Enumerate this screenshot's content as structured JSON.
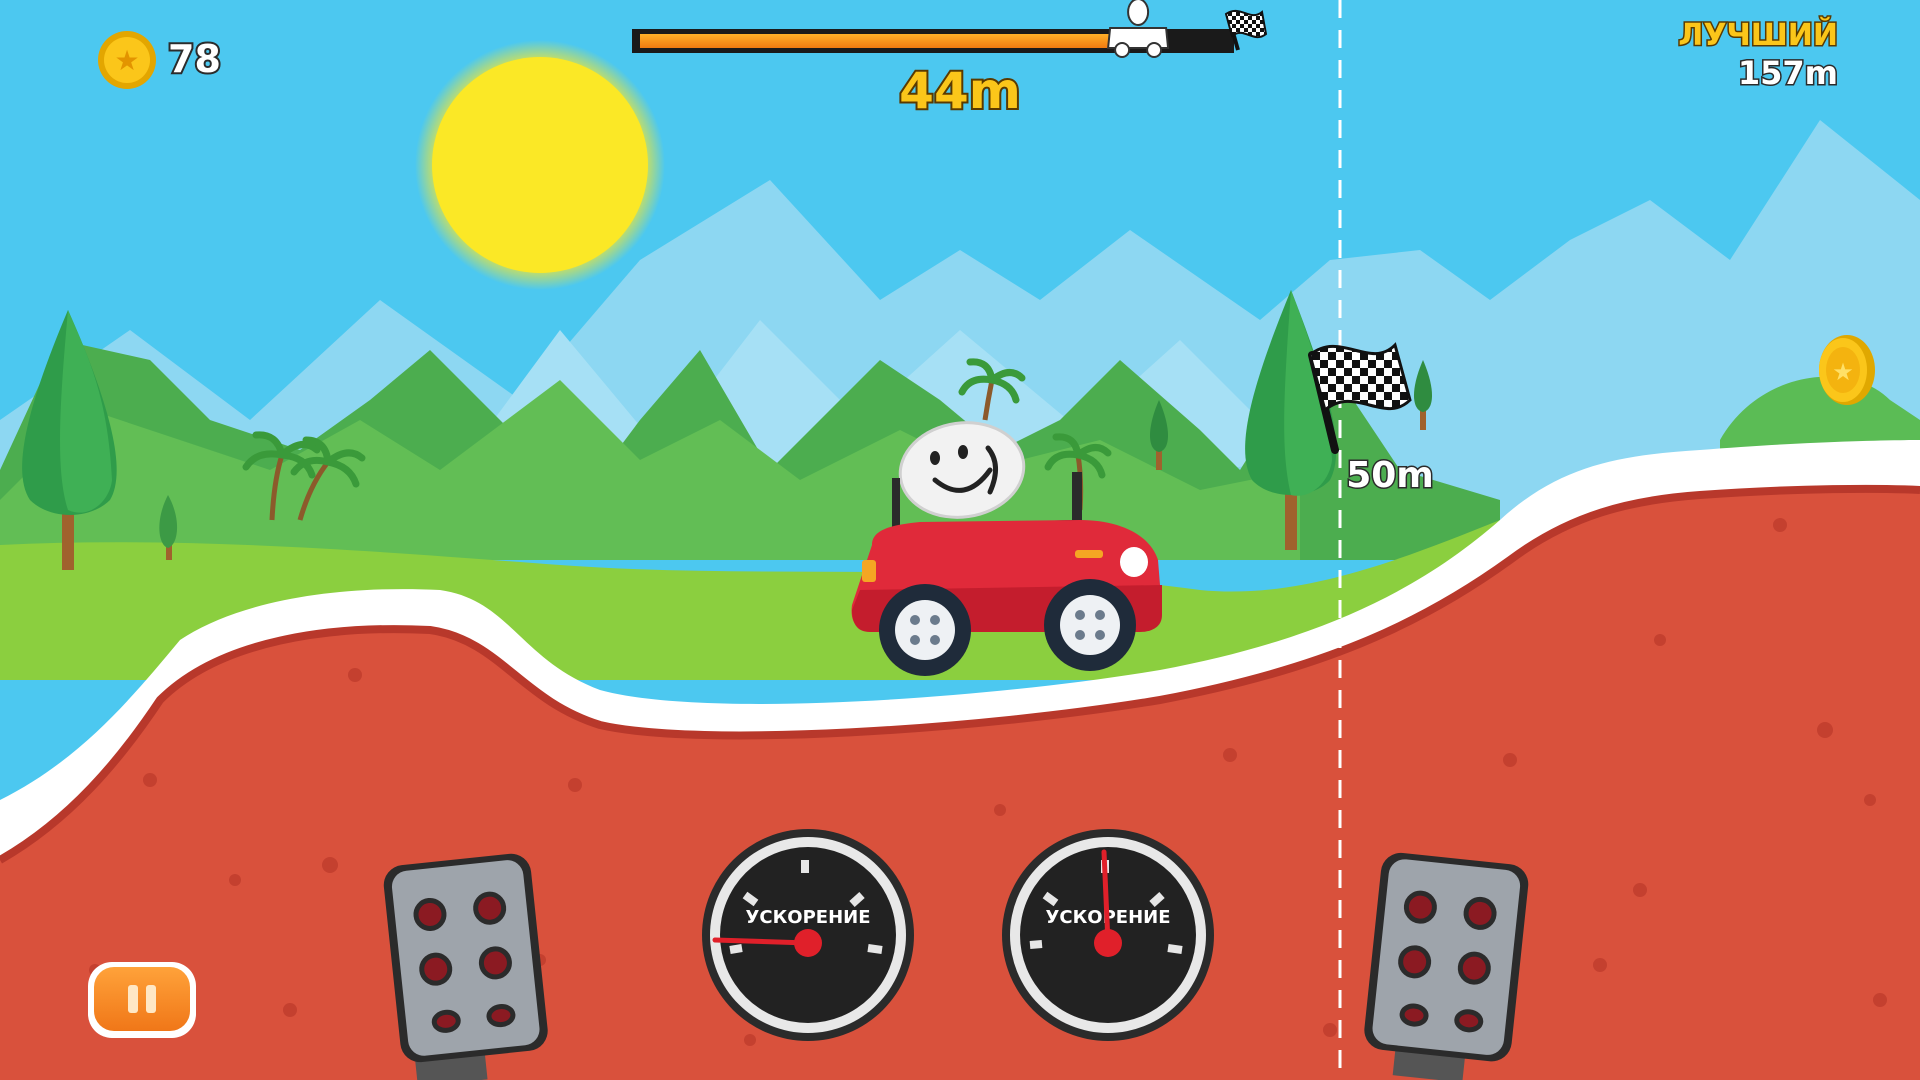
{
  "hud": {
    "coins": "78",
    "distance": "44m",
    "best_label": "ЛУЧШИЙ",
    "best_value": "157m",
    "progress_fraction": 0.85
  },
  "checkpoint": {
    "label": "50m"
  },
  "gauges": {
    "left_label": "УСКОРЕНИЕ",
    "right_label": "УСКОРЕНИЕ"
  },
  "icons": {
    "coin": "coin-star-icon",
    "pause": "pause-icon",
    "flag": "checkered-flag-icon",
    "car_marker": "car-progress-marker-icon"
  },
  "colors": {
    "sky": "#4cc8f0",
    "ground": "#d9513c",
    "grass": "#8bcf3f",
    "road_edge": "#ffffff",
    "car": "#e02a3a",
    "progress": "#f7941d",
    "coin": "#f5c211",
    "gauge_needle": "#e0202a"
  }
}
